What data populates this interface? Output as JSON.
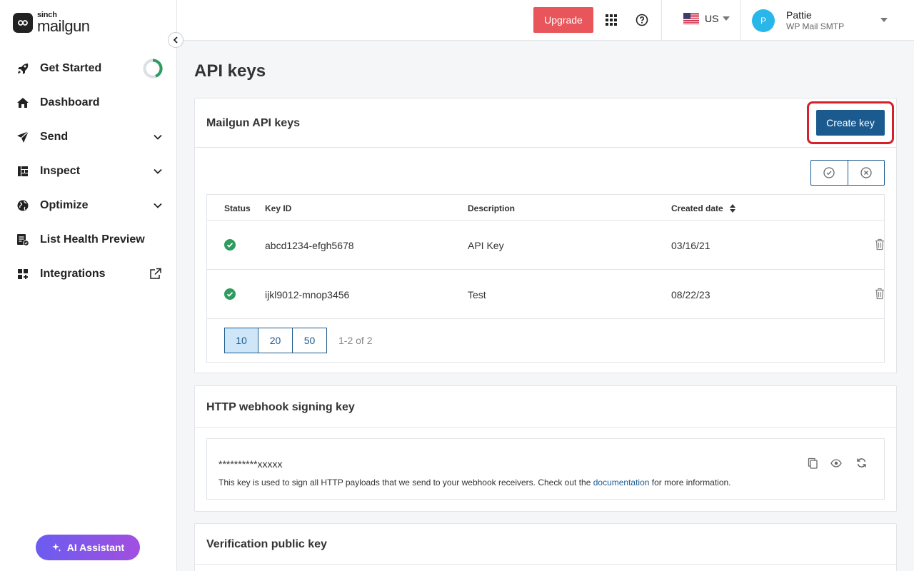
{
  "brand": {
    "sub": "sinch",
    "name": "mailgun"
  },
  "colors": {
    "primary": "#1b5a8e",
    "upgrade": "#e8555a",
    "success": "#2e9b5f",
    "highlight": "#d6202a",
    "avatar": "#29b6e8"
  },
  "sidebar": {
    "items": [
      {
        "label": "Get Started",
        "icon": "rocket-icon"
      },
      {
        "label": "Dashboard",
        "icon": "home-icon"
      },
      {
        "label": "Send",
        "icon": "paper-plane-icon"
      },
      {
        "label": "Inspect",
        "icon": "grid-report-icon"
      },
      {
        "label": "Optimize",
        "icon": "globe-icon"
      },
      {
        "label": "List Health Preview",
        "icon": "list-check-icon"
      },
      {
        "label": "Integrations",
        "icon": "apps-plus-icon"
      }
    ],
    "ai_assistant": "AI Assistant"
  },
  "header": {
    "upgrade": "Upgrade",
    "region": "US",
    "user": {
      "initial": "P",
      "name": "Pattie",
      "org": "WP Mail SMTP"
    }
  },
  "page": {
    "title": "API keys"
  },
  "api_keys": {
    "title": "Mailgun API keys",
    "create_label": "Create key",
    "columns": [
      "Status",
      "Key ID",
      "Description",
      "Created date"
    ],
    "rows": [
      {
        "key_id": "abcd1234-efgh5678",
        "description": "API Key",
        "created": "03/16/21"
      },
      {
        "key_id": "ijkl9012-mnop3456",
        "description": "Test",
        "created": "08/22/23"
      }
    ],
    "page_sizes": [
      "10",
      "20",
      "50"
    ],
    "count": "1-2 of 2"
  },
  "webhook": {
    "title": "HTTP webhook signing key",
    "value": "**********xxxxx",
    "desc_before": "This key is used to sign all HTTP payloads that we send to your webhook receivers. Check out the ",
    "desc_link": "documentation",
    "desc_after": " for more information."
  },
  "verification": {
    "title": "Verification public key"
  }
}
